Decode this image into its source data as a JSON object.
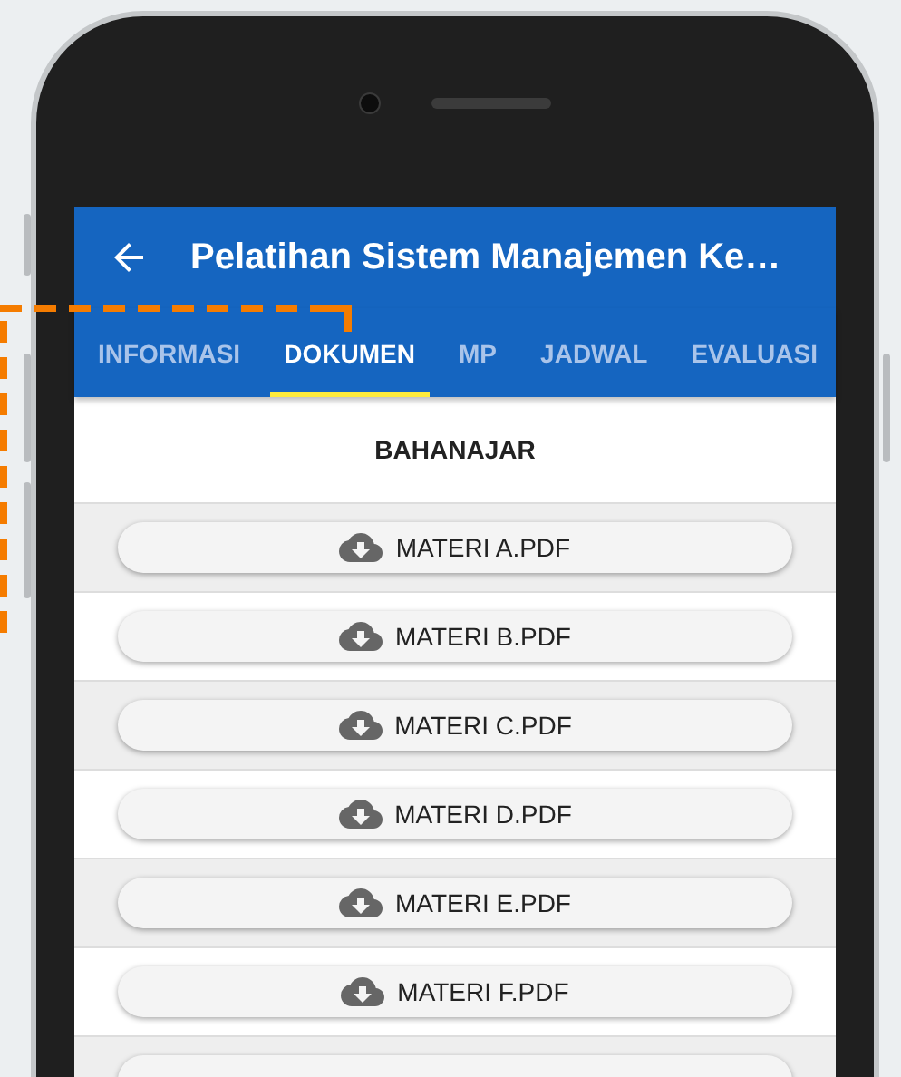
{
  "app_bar": {
    "title": "Pelatihan Sistem Manajemen Ke…"
  },
  "tabs": [
    {
      "label": "INFORMASI",
      "selected": false
    },
    {
      "label": "DOKUMEN",
      "selected": true
    },
    {
      "label": "MP",
      "selected": false
    },
    {
      "label": "JADWAL",
      "selected": false
    },
    {
      "label": "EVALUASI",
      "selected": false
    }
  ],
  "section_header": "BAHANAJAR",
  "files": [
    {
      "label": "MATERI A.PDF"
    },
    {
      "label": "MATERI B.PDF"
    },
    {
      "label": "MATERI C.PDF"
    },
    {
      "label": "MATERI D.PDF"
    },
    {
      "label": "MATERI E.PDF"
    },
    {
      "label": "MATERI F.PDF"
    }
  ]
}
